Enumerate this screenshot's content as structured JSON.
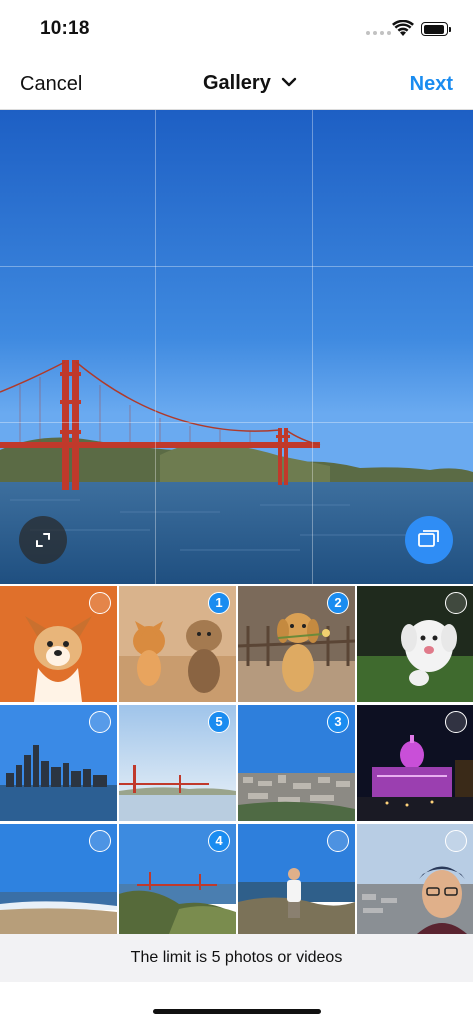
{
  "status_bar": {
    "time": "10:18",
    "battery_level": 0.9
  },
  "nav": {
    "cancel_label": "Cancel",
    "title": "Gallery",
    "next_label": "Next"
  },
  "preview": {
    "expand_icon": "expand-crop-icon",
    "multi_select_icon": "multi-select-icon"
  },
  "thumbnails": [
    {
      "subject": "corgi-orange",
      "selection": ""
    },
    {
      "subject": "corgi-yorkie",
      "selection": "1"
    },
    {
      "subject": "golden-puppy-flower",
      "selection": "2"
    },
    {
      "subject": "white-dog-running",
      "selection": ""
    },
    {
      "subject": "city-skyline",
      "selection": ""
    },
    {
      "subject": "golden-gate-distant",
      "selection": "5"
    },
    {
      "subject": "city-view",
      "selection": "3"
    },
    {
      "subject": "city-hall-night",
      "selection": ""
    },
    {
      "subject": "beach",
      "selection": ""
    },
    {
      "subject": "bridge-hills",
      "selection": "4"
    },
    {
      "subject": "person-coast",
      "selection": ""
    },
    {
      "subject": "selfie",
      "selection": ""
    }
  ],
  "limit_text": "The limit is 5 photos or videos",
  "colors": {
    "accent": "#1a8cf0",
    "sky": "#2a6fd1",
    "bridge": "#c0392b"
  }
}
